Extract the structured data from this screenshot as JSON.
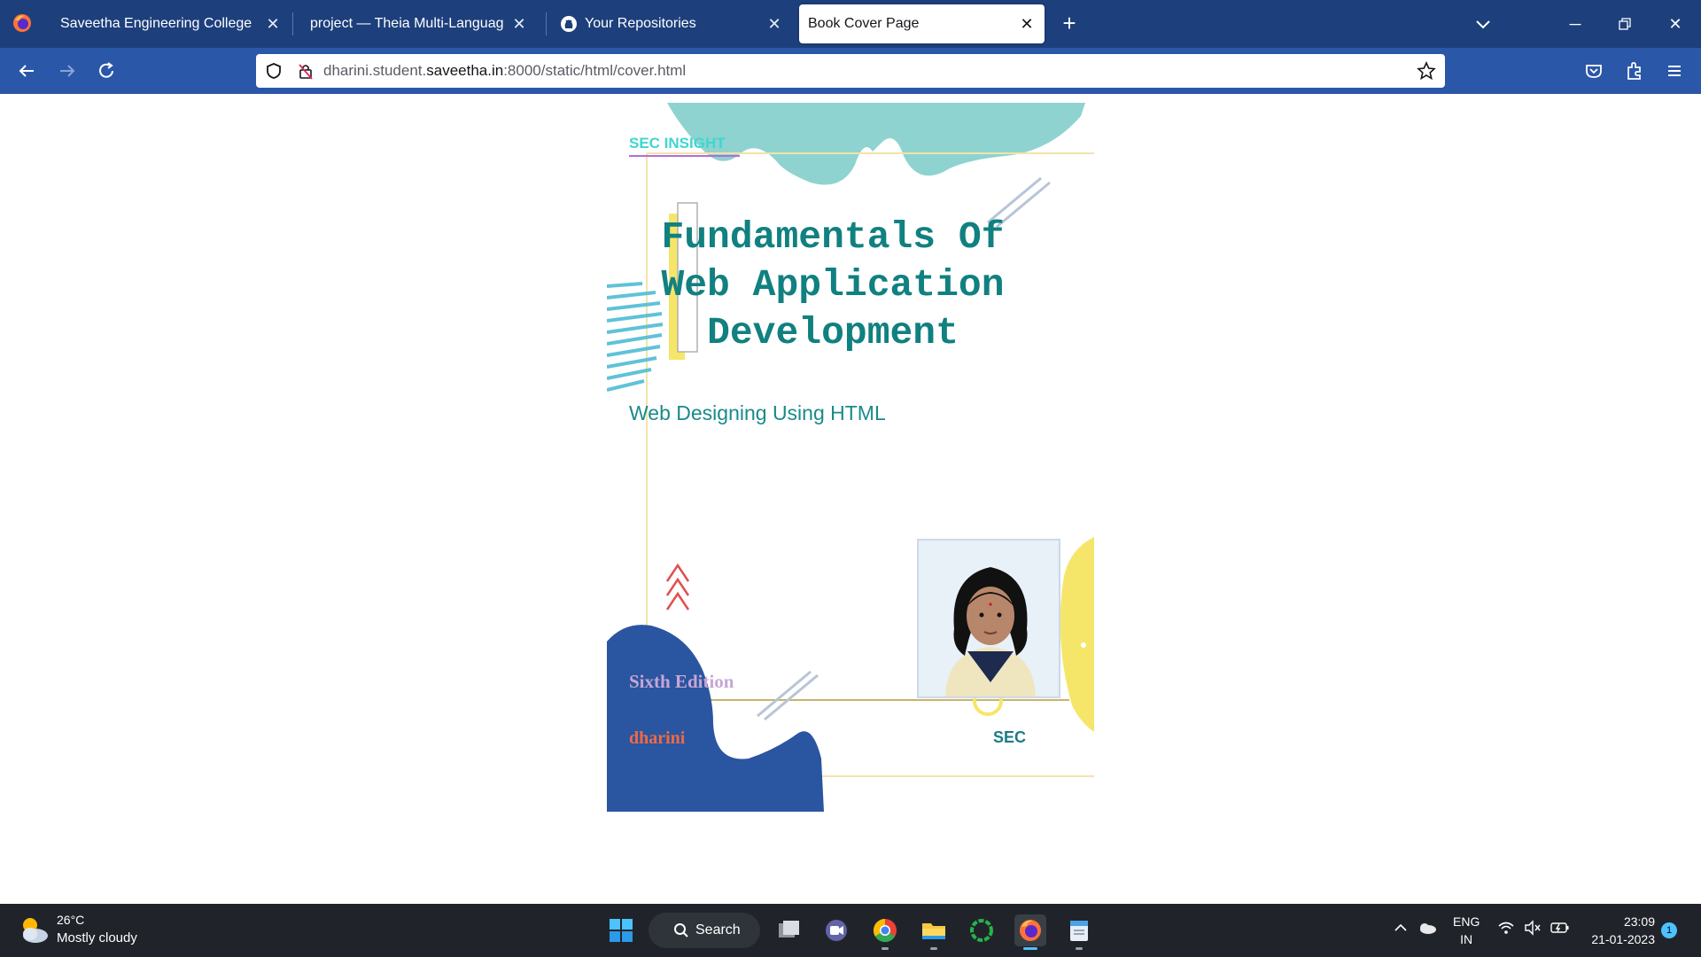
{
  "browser": {
    "tabs": [
      {
        "label": "Saveetha Engineering College",
        "active": false
      },
      {
        "label": "project — Theia Multi-Language Ex",
        "active": false
      },
      {
        "label": "Your Repositories",
        "active": false
      },
      {
        "label": "Book Cover Page",
        "active": true
      }
    ],
    "url": {
      "host_prefix": "dharini.student.",
      "host_main": "saveetha.in",
      "path": ":8000/static/html/cover.html"
    }
  },
  "cover": {
    "brand": "SEC INSIGHT",
    "title_lines": [
      "Fundamentals Of",
      "Web Application",
      "Development"
    ],
    "subtitle": "Web Designing Using HTML",
    "edition": "Sixth Edition",
    "author": "dharini",
    "publisher": "SEC"
  },
  "taskbar": {
    "weather_temp": "26°C",
    "weather_desc": "Mostly cloudy",
    "search_label": "Search",
    "lang_line1": "ENG",
    "lang_line2": "IN",
    "time": "23:09",
    "date": "21-01-2023",
    "notification_count": "1"
  },
  "colors": {
    "tabbar": "#1d3f7c",
    "navbar": "#2b57a8",
    "title": "#118080",
    "cover_blue": "#2a55a0",
    "cover_teal": "#8ed3d0",
    "cover_yellow": "#f5e66a"
  }
}
